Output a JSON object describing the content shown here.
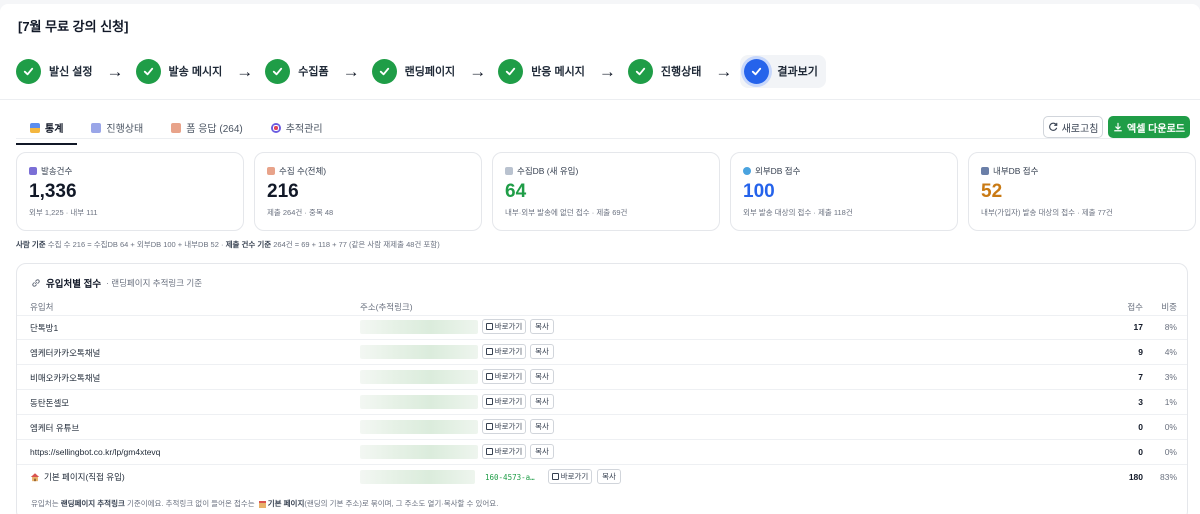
{
  "page_title": "[7월 무료 강의 신청]",
  "steps": [
    {
      "label": "발신 설정",
      "state": "done"
    },
    {
      "label": "발송 메시지",
      "state": "done"
    },
    {
      "label": "수집폼",
      "state": "done"
    },
    {
      "label": "랜딩페이지",
      "state": "done"
    },
    {
      "label": "반응 메시지",
      "state": "done"
    },
    {
      "label": "진행상태",
      "state": "done"
    },
    {
      "label": "결과보기",
      "state": "active"
    }
  ],
  "step_arrow": "→",
  "tabs": [
    {
      "label": "통계",
      "icon": "chart-icon",
      "active": true
    },
    {
      "label": "진행상태",
      "icon": "progress-icon",
      "active": false
    },
    {
      "label": "폼 응답 (264)",
      "icon": "form-icon",
      "active": false
    },
    {
      "label": "추적관리",
      "icon": "target-icon",
      "active": false
    }
  ],
  "toolbar": {
    "refresh_label": "새로고침",
    "excel_label": "엑셀 다운로드"
  },
  "cards": [
    {
      "label": "발송건수",
      "icon": "send-icon",
      "value": "1,336",
      "sub": "외부 1,225 · 내부 111",
      "color": "#111827"
    },
    {
      "label": "수집 수(전체)",
      "icon": "clipboard-icon",
      "value": "216",
      "sub": "제출 264건 · 중복 48",
      "color": "#111827"
    },
    {
      "label": "수집DB (새 유입)",
      "icon": "db-icon",
      "value": "64",
      "sub": "내부·외부 발송에 없던 접수 · 제출 69건",
      "color": "#1f9d47"
    },
    {
      "label": "외부DB 접수",
      "icon": "globe-icon",
      "value": "100",
      "sub": "외부 발송 대상의 접수 · 제출 118건",
      "color": "#2563eb"
    },
    {
      "label": "내부DB 접수",
      "icon": "people-icon",
      "value": "52",
      "sub": "내부(가입자) 발송 대상의 접수 · 제출 77건",
      "color": "#c97a14"
    }
  ],
  "basis": {
    "a_label": "사람 기준",
    "a_text": " 수집 수 216 = 수집DB 64 + 외부DB 100 + 내부DB 52 · ",
    "b_label": "제출 건수 기준",
    "b_text": " 264건 = 69 + 118 + 77 (같은 사람 재제출 48건 포함)"
  },
  "source_panel": {
    "title": "유입처별 접수",
    "subtitle": "· 랜딩페이지 추적링크 기준",
    "columns": {
      "source": "유입처",
      "address": "주소(추적링크)",
      "count": "접수",
      "ratio": "비중"
    },
    "go_label": "바로가기",
    "copy_label": "복사",
    "rows": [
      {
        "source": "단톡방1",
        "link": "",
        "count": "17",
        "ratio": "8%"
      },
      {
        "source": "엠케터카카오톡채널",
        "link": "",
        "count": "9",
        "ratio": "4%"
      },
      {
        "source": "비매오카카오톡채널",
        "link": "",
        "count": "7",
        "ratio": "3%"
      },
      {
        "source": "동탄돈셀모",
        "link": "",
        "count": "3",
        "ratio": "1%"
      },
      {
        "source": "엠케터 유튜브",
        "link": "",
        "count": "0",
        "ratio": "0%"
      },
      {
        "source": "https://sellingbot.co.kr/lp/gm4xtevq",
        "link": "",
        "count": "0",
        "ratio": "0%"
      },
      {
        "source": "기본 페이지(직접 유입)",
        "link": "160-4573-a…",
        "count": "180",
        "ratio": "83%"
      }
    ],
    "footer": {
      "t1": "유입처는 ",
      "b1": "랜딩페이지 추적링크",
      "t2": " 기준이에요. 추적링크 없이 들어온 접수는 ",
      "b2": "기본 페이지",
      "t3": "(랜딩의 기본 주소)로 묶이며, 그 주소도 열기·복사할 수 있어요."
    }
  }
}
